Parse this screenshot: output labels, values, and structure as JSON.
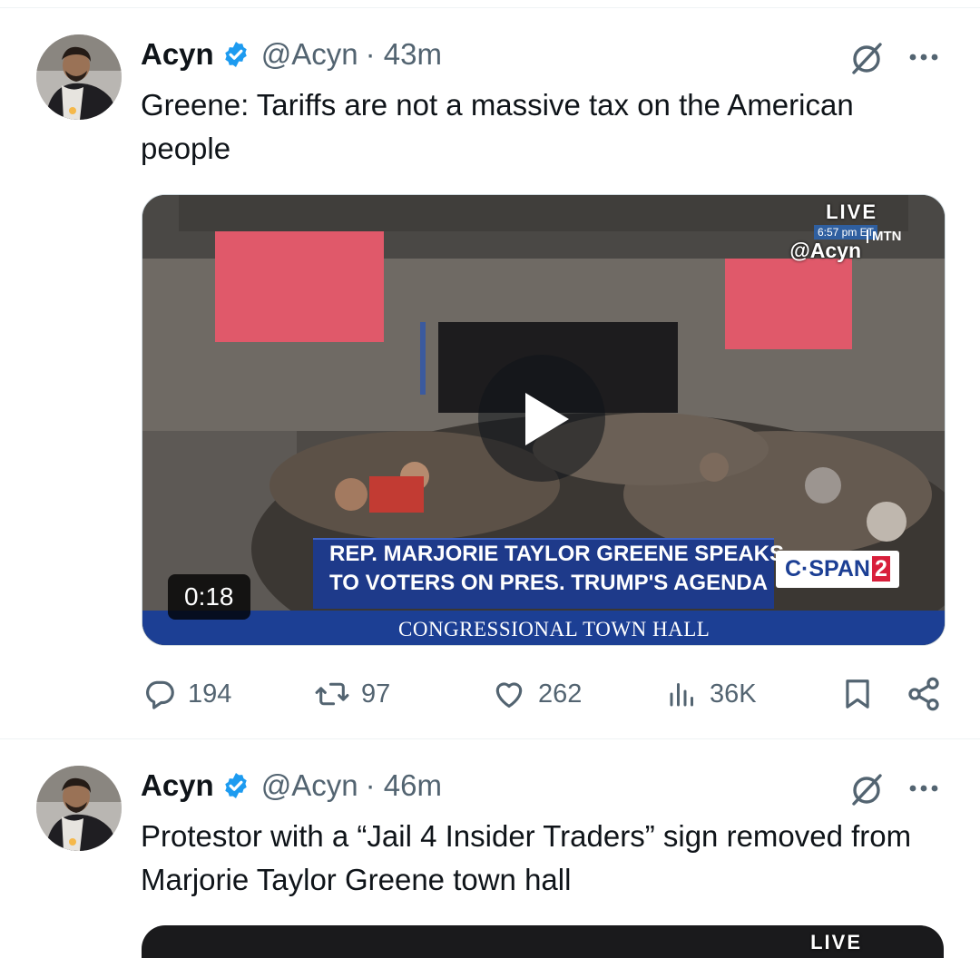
{
  "tweets": [
    {
      "author_name": "Acyn",
      "handle": "@Acyn",
      "time": "· 43m",
      "text": "Greene: Tariffs are not a massive tax on the American people",
      "media": {
        "live": "LIVE",
        "live_time": "6:57 pm ET",
        "watermark": "@Acyn",
        "mtn": "MTN",
        "headline_1": "REP. MARJORIE TAYLOR GREENE SPEAKS",
        "headline_2": "TO VOTERS ON PRES. TRUMP'S AGENDA",
        "network": "C·SPAN",
        "network_number": "2",
        "footer": "CONGRESSIONAL TOWN HALL",
        "duration": "0:18"
      },
      "actions": {
        "replies": "194",
        "reposts": "97",
        "likes": "262",
        "views": "36K"
      }
    },
    {
      "author_name": "Acyn",
      "handle": "@Acyn",
      "time": "· 46m",
      "text": "Protestor with a “Jail 4 Insider Traders” sign removed from Marjorie Taylor Greene town hall",
      "media": {
        "live": "LIVE"
      }
    }
  ],
  "colors": {
    "verified": "#1d9bf0",
    "secondary_text": "#536471",
    "primary_text": "#0f1419",
    "divider": "#eff3f4"
  },
  "icons": [
    "verified-badge-icon",
    "grok-icon",
    "more-icon",
    "reply-icon",
    "retweet-icon",
    "like-icon",
    "views-icon",
    "bookmark-icon",
    "share-icon",
    "play-icon"
  ]
}
